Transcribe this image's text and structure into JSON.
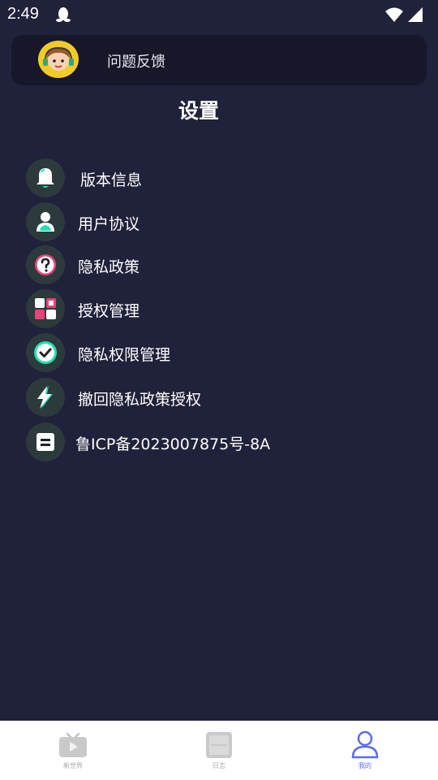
{
  "status_bar": {
    "time": "2:49"
  },
  "feedback": {
    "label": "问题反馈"
  },
  "page": {
    "title": "设置"
  },
  "menu": [
    {
      "label": "版本信息",
      "icon": "bell-icon"
    },
    {
      "label": "用户协议",
      "icon": "user-icon"
    },
    {
      "label": "隐私政策",
      "icon": "question-icon"
    },
    {
      "label": "授权管理",
      "icon": "grid-icon"
    },
    {
      "label": "隐私权限管理",
      "icon": "check-icon"
    },
    {
      "label": "撤回隐私政策授权",
      "icon": "lightning-icon"
    },
    {
      "label": "鲁ICP备2023007875号-8A",
      "icon": "id-card-icon"
    }
  ],
  "nav": [
    {
      "label": "新世界",
      "icon": "tv-play-icon",
      "active": false
    },
    {
      "label": "日志",
      "icon": "frame-icon",
      "active": false
    },
    {
      "label": "我的",
      "icon": "person-icon",
      "active": true
    }
  ],
  "colors": {
    "background": "#20213a",
    "card": "#161729",
    "icon_bg": "#2c3a3c",
    "accent_teal": "#1ee0b6",
    "accent_pink": "#f0407a",
    "nav_active": "#5b6bf5"
  }
}
